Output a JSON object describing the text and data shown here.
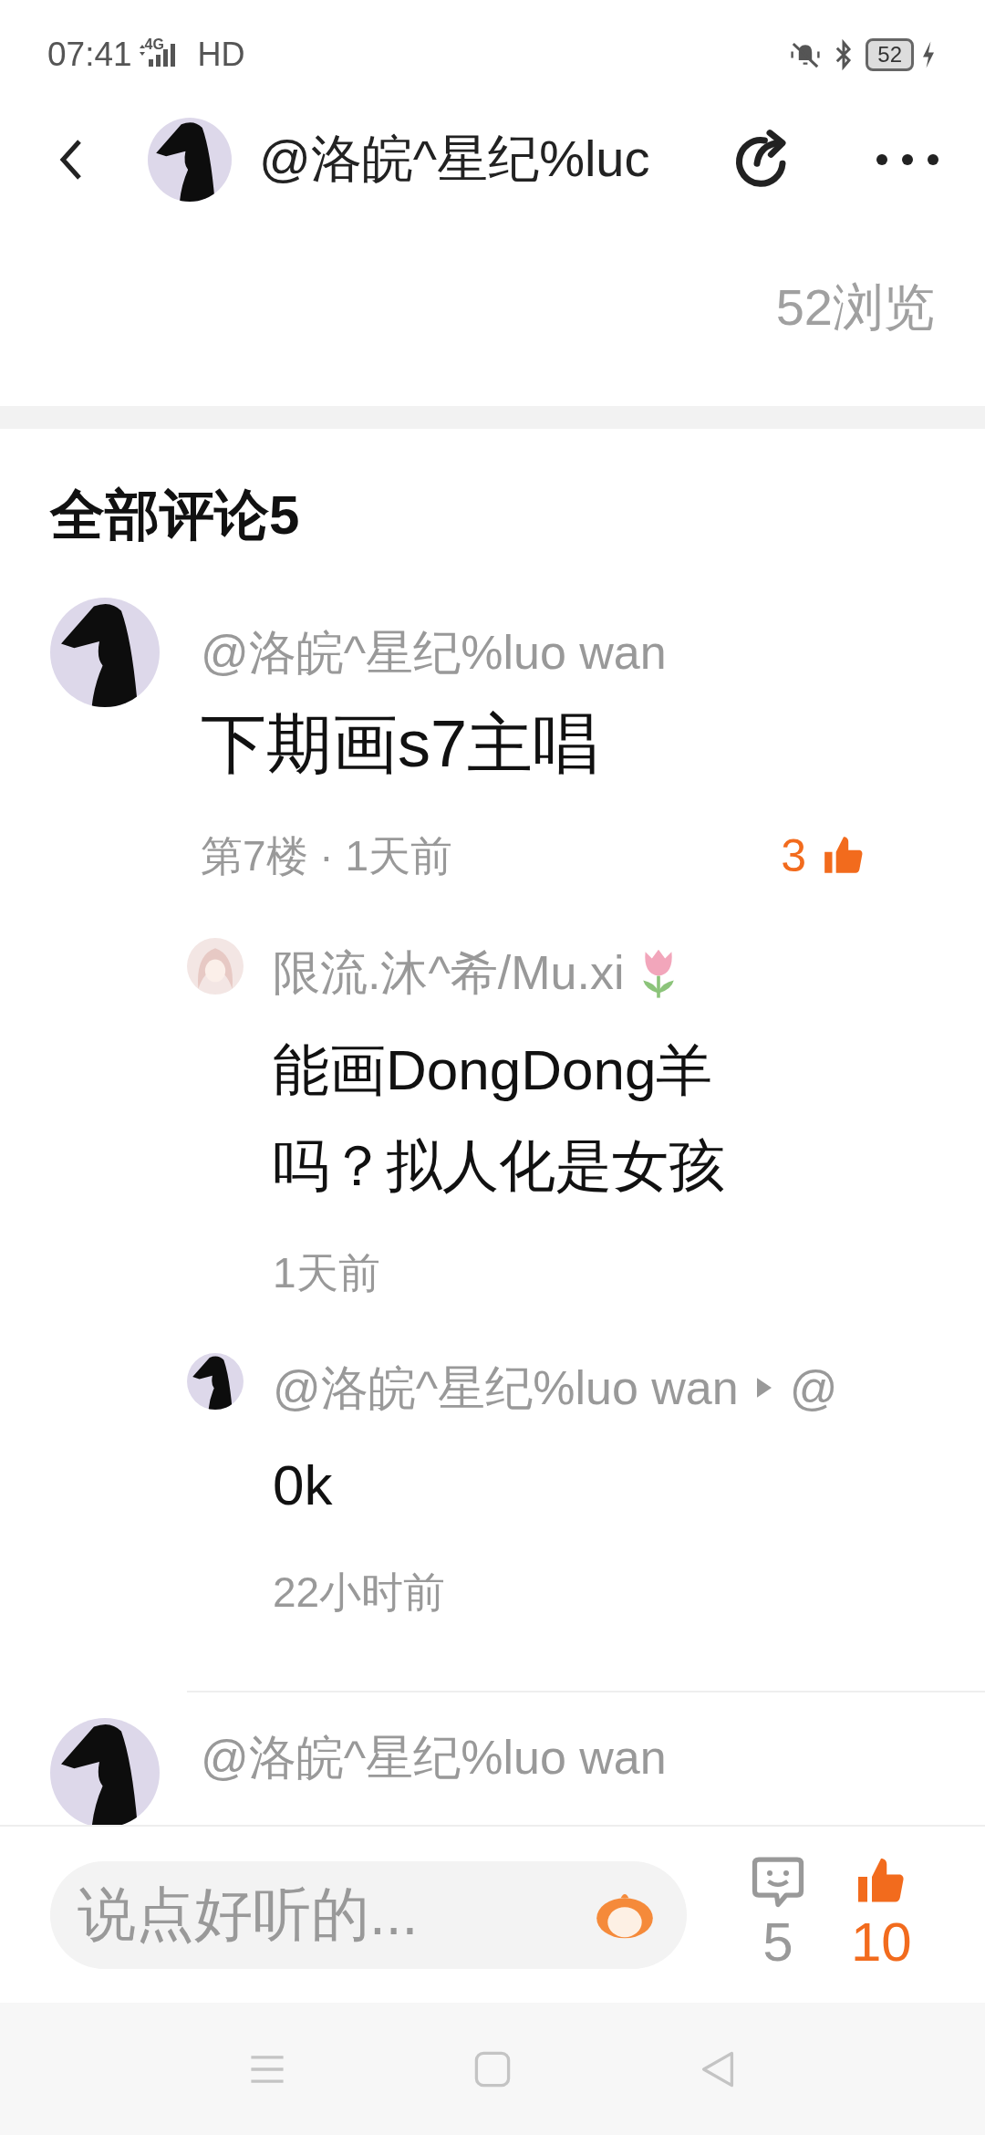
{
  "status_bar": {
    "time": "07:41",
    "network": "4G",
    "hd": "HD",
    "battery": "52"
  },
  "header": {
    "title": "@洛皖^星纪%luc"
  },
  "views": "52浏览",
  "comments_header": "全部评论5",
  "comments": [
    {
      "author": "@洛皖^星纪%luo wan",
      "text": "下期画s7主唱",
      "meta": "第7楼 · 1天前",
      "likes": "3",
      "replies": [
        {
          "author": "限流.沐^希/Mu.xi",
          "kind": "badge",
          "text": "能画DongDong羊吗？拟人化是女孩",
          "time": "1天前"
        },
        {
          "author": "@洛皖^星纪%luo wan",
          "kind": "mention",
          "reply_to": "@",
          "text": "0k",
          "time": "22小时前"
        }
      ]
    },
    {
      "author": "@洛皖^星纪%luo wan"
    }
  ],
  "comment_input": {
    "placeholder": "说点好听的..."
  },
  "comment_count": "5",
  "like_count": "10"
}
